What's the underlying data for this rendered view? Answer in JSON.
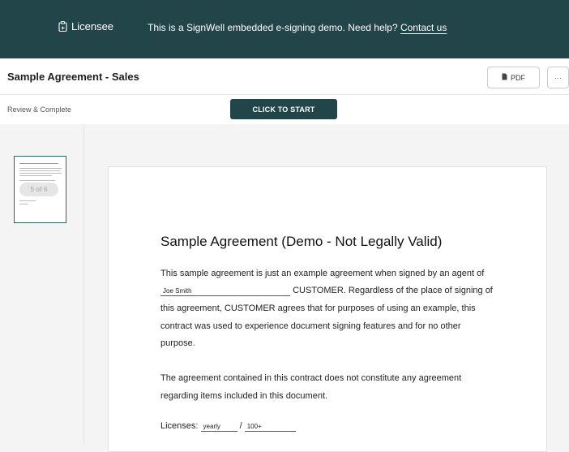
{
  "topbar": {
    "brand": "Licensee",
    "banner_text": "This is a SignWell embedded e-signing demo. Need help?",
    "contact_link": "Contact us"
  },
  "header": {
    "title": "Sample Agreement - Sales",
    "pdf_label": "PDF",
    "more_label": "···"
  },
  "subbar": {
    "status": "Review & Complete",
    "start_label": "CLICK TO START"
  },
  "sidebar": {
    "thumbnail_badge": "5 of 6"
  },
  "document": {
    "heading": "Sample Agreement (Demo - Not Legally Valid)",
    "p1_line1": "This sample agreement is just an example agreement when signed by an agent of",
    "name_field": "Joe Smith",
    "p1_line2_tail": "CUSTOMER. Regardless of the place of signing of",
    "p1_line3": "this agreement, CUSTOMER agrees that for purposes of using an example, this",
    "p1_line4": "contract was used to experience document signing features and for no other",
    "p1_line5": "purpose.",
    "p2_line1": "The agreement contained in this contract does not constitute any agreement",
    "p2_line2": "regarding items included in this document.",
    "licenses_label": "Licenses:",
    "licenses_term": "yearly",
    "licenses_sep": "/",
    "licenses_count": "100+"
  },
  "colors": {
    "brand_dark": "#224549"
  }
}
